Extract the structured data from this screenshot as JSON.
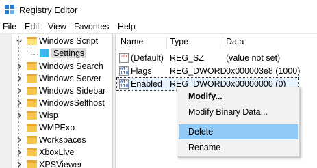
{
  "window": {
    "title": "Registry Editor",
    "app_icon": "registry-editor-icon"
  },
  "menu": [
    "File",
    "Edit",
    "View",
    "Favorites",
    "Help"
  ],
  "tree": {
    "parent": "Windows Script",
    "selected_child": "Settings",
    "items": [
      "Windows Search",
      "Windows Server",
      "Windows Sidebar",
      "WindowsSelfhost",
      "Wisp",
      "WMPExp",
      "Workspaces",
      "XboxLive",
      "XPSViewer"
    ]
  },
  "list": {
    "columns": [
      "Name",
      "Type",
      "Data"
    ],
    "rows": [
      {
        "name": "(Default)",
        "type": "REG_SZ",
        "data": "(value not set)",
        "icon": "string-value-icon"
      },
      {
        "name": "Flags",
        "type": "REG_DWORD",
        "data": "0x000003e8 (1000)",
        "icon": "dword-value-icon"
      },
      {
        "name": "Enabled",
        "type": "REG_DWORD",
        "data": "0x00000000 (0)",
        "icon": "dword-value-icon"
      }
    ]
  },
  "context_menu": {
    "items": [
      "Modify...",
      "Modify Binary Data...",
      "Delete",
      "Rename"
    ],
    "highlighted": "Delete"
  },
  "colors": {
    "highlight": "#91c9f7",
    "selection_folder": "#3db7ea",
    "folder": "#f5c54d"
  }
}
